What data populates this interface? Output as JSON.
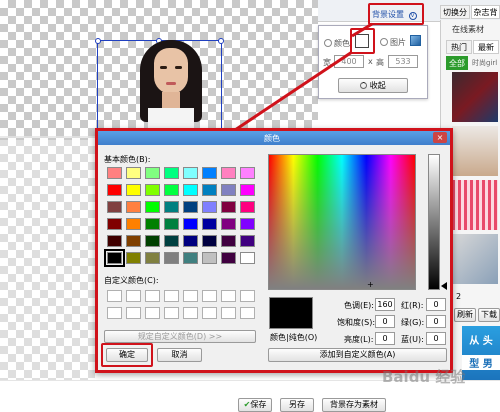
{
  "top_bar": {
    "bg_settings_label": "背景设置",
    "category_tab": "切换分类",
    "magazine_tab": "杂志背"
  },
  "side_panel": {
    "online_material": "在线素材",
    "tab_hot": "热门",
    "tab_new": "最新",
    "tab_all": "全部",
    "tab_fashion": "时尚girl",
    "page_prefix": "2",
    "refresh_label": "刷新",
    "download_label": "下载",
    "banner_line1": "从 头",
    "banner_line2": "型 男"
  },
  "bg_popup": {
    "radio_color": "颜色",
    "radio_image": "图片",
    "width_label": "宽",
    "width_value": "400",
    "x_label": "x",
    "height_label": "高",
    "height_value": "533",
    "collapse_label": "收起"
  },
  "color_dialog": {
    "title": "颜色",
    "basic_colors_label": "基本颜色(B):",
    "custom_colors_label": "自定义颜色(C):",
    "define_custom_label": "规定自定义颜色(D) >>",
    "ok_label": "确定",
    "cancel_label": "取消",
    "solid_label": "颜色|纯色(O)",
    "hue_label": "色调(E):",
    "hue_value": "160",
    "sat_label": "饱和度(S):",
    "sat_value": "0",
    "lum_label": "亮度(L):",
    "lum_value": "0",
    "red_label": "红(R):",
    "red_value": "0",
    "green_label": "绿(G):",
    "green_value": "0",
    "blue_label": "蓝(U):",
    "blue_value": "0",
    "add_custom_label": "添加到自定义颜色(A)",
    "basic_colors": [
      "#ff8080",
      "#ffff80",
      "#80ff80",
      "#00ff80",
      "#80ffff",
      "#0080ff",
      "#ff80c0",
      "#ff80ff",
      "#ff0000",
      "#ffff00",
      "#80ff00",
      "#00ff40",
      "#00ffff",
      "#0080c0",
      "#8080c0",
      "#ff00ff",
      "#804040",
      "#ff8040",
      "#00ff00",
      "#008080",
      "#004080",
      "#8080ff",
      "#800040",
      "#ff0080",
      "#800000",
      "#ff8000",
      "#008000",
      "#008040",
      "#0000ff",
      "#0000a0",
      "#800080",
      "#8000ff",
      "#400000",
      "#804000",
      "#004000",
      "#004040",
      "#000080",
      "#000040",
      "#400040",
      "#400080",
      "#000000",
      "#808000",
      "#808040",
      "#808080",
      "#408080",
      "#c0c0c0",
      "#400040",
      "#ffffff"
    ],
    "selected_color": "#000000"
  },
  "bottom_bar": {
    "save_label": "保存",
    "save_as_label": "另存",
    "save_material_label": "背景存为素材"
  },
  "watermark": "Baidu 经验"
}
